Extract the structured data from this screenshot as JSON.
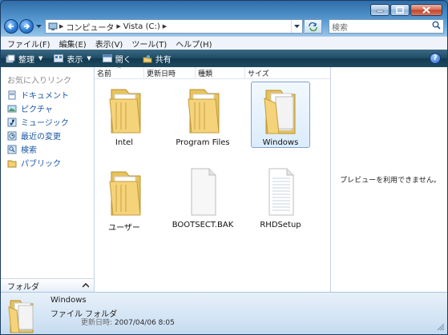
{
  "address": {
    "segments": [
      "コンピュータ",
      "Vista (C:)"
    ]
  },
  "search": {
    "placeholder": "検索"
  },
  "menu": [
    "ファイル(F)",
    "編集(E)",
    "表示(V)",
    "ツール(T)",
    "ヘルプ(H)"
  ],
  "toolbar": {
    "organize": "整理",
    "views": "表示",
    "open": "開く",
    "share": "共有",
    "help": "?"
  },
  "sidebar": {
    "heading": "お気に入りリンク",
    "items": [
      {
        "label": "ドキュメント",
        "icon": "documents-icon"
      },
      {
        "label": "ピクチャ",
        "icon": "pictures-icon"
      },
      {
        "label": "ミュージック",
        "icon": "music-icon"
      },
      {
        "label": "最近の変更",
        "icon": "recent-icon"
      },
      {
        "label": "検索",
        "icon": "search-folder-icon"
      },
      {
        "label": "パブリック",
        "icon": "public-folder-icon"
      }
    ],
    "folders_label": "フォルダ"
  },
  "columns": [
    "名前",
    "更新日時",
    "種類",
    "サイズ"
  ],
  "files": [
    {
      "name": "Intel",
      "kind": "folder"
    },
    {
      "name": "Program Files",
      "kind": "folder"
    },
    {
      "name": "Windows",
      "kind": "folder",
      "selected": true
    },
    {
      "name": "ユーザー",
      "kind": "folder"
    },
    {
      "name": "BOOTSECT.BAK",
      "kind": "file"
    },
    {
      "name": "RHDSetup",
      "kind": "text-file"
    }
  ],
  "preview": {
    "message": "プレビューを利用できません。"
  },
  "details": {
    "name": "Windows",
    "type": "ファイル フォルダ",
    "date_label": "更新日時:",
    "date_value": "2007/04/06 8:05"
  },
  "colors": {
    "accent": "#1a56a3",
    "command_bar": "#1f4b63",
    "folder": "#f4d37a"
  }
}
